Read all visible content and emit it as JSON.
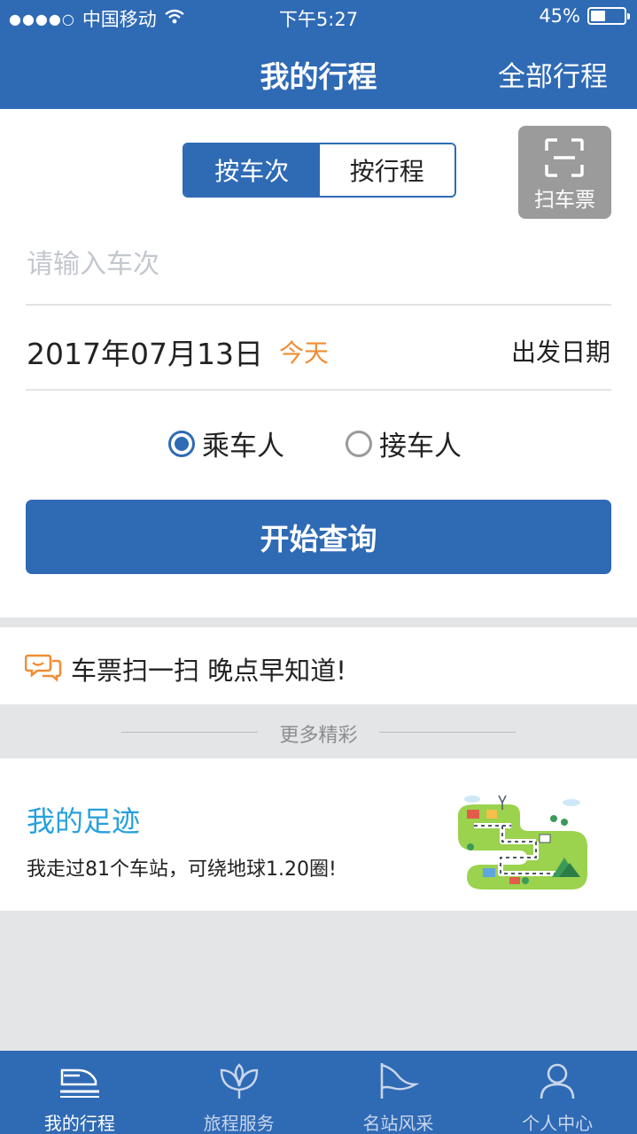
{
  "status": {
    "signal": "●●●●○",
    "carrier": "中国移动",
    "time": "下午5:27",
    "battery": "45%",
    "battery_level": 0.45
  },
  "nav": {
    "title": "我的行程",
    "action": "全部行程"
  },
  "query": {
    "tab_train": "按车次",
    "tab_trip": "按行程",
    "scan_label": "扫车票",
    "placeholder": "请输入车次",
    "date": "2017年07月13日",
    "today": "今天",
    "date_label": "出发日期",
    "role_passenger": "乘车人",
    "role_pickup": "接车人",
    "search_button": "开始查询"
  },
  "notice": {
    "text": "车票扫一扫 晚点早知道!"
  },
  "more": {
    "text": "更多精彩"
  },
  "footprint": {
    "title": "我的足迹",
    "subtitle": "我走过81个车站，可绕地球1.20圈!"
  },
  "tabs": [
    {
      "label": "我的行程",
      "icon": "train-icon"
    },
    {
      "label": "旅程服务",
      "icon": "lotus-icon"
    },
    {
      "label": "名站风采",
      "icon": "flag-icon"
    },
    {
      "label": "个人中心",
      "icon": "person-icon"
    }
  ],
  "colors": {
    "primary": "#2f6ab5",
    "accent_orange": "#f08d35",
    "link_blue": "#26a0dc"
  }
}
